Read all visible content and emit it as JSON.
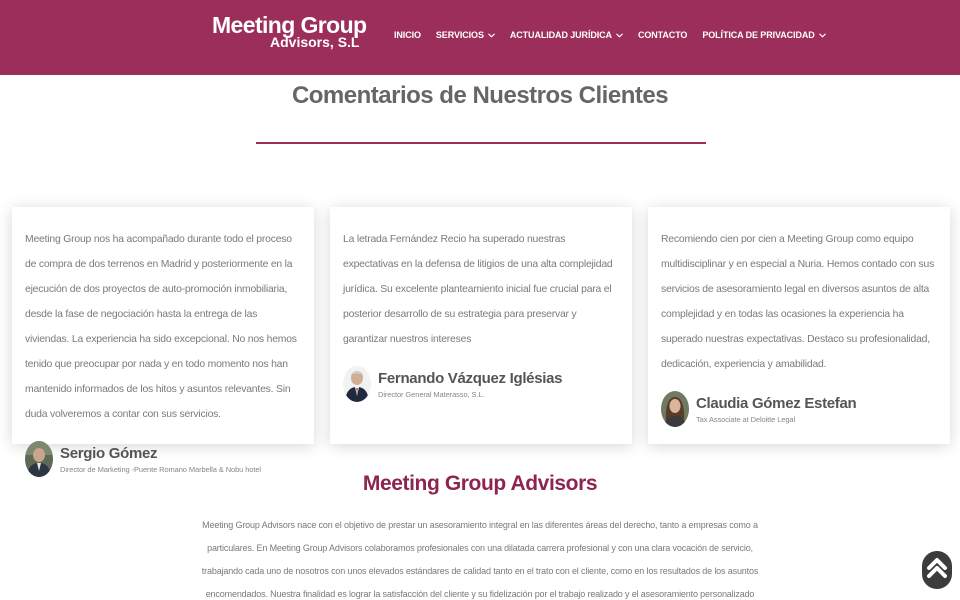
{
  "header": {
    "logo_line1": "Meeting Group",
    "logo_line2": "Advisors, S.L",
    "nav": [
      {
        "label": "INICIO",
        "dropdown": false
      },
      {
        "label": "SERVICIOS",
        "dropdown": true
      },
      {
        "label": "ACTUALIDAD JURÍDICA",
        "dropdown": true
      },
      {
        "label": "CONTACTO",
        "dropdown": false
      },
      {
        "label": "POLÍTICA DE PRIVACIDAD",
        "dropdown": true
      }
    ]
  },
  "testimonials": {
    "title": "Comentarios de Nuestros Clientes",
    "items": [
      {
        "text": "Meeting Group nos ha acompañado durante todo el proceso de compra de dos terrenos en Madrid y posteriormente en la ejecución de dos proyectos de auto-promoción inmobiliaria, desde la fase de negociación hasta la entrega de las viviendas. La experiencia ha sido excepcional. No nos hemos tenido que preocupar por nada y en todo momento nos han mantenido informados de los hitos y asuntos relevantes. Sin duda volveremos a contar con sus servicios.",
        "name": "Sergio Gómez",
        "role": "Director de Marketing -Puente Romano Marbella & Nobu hotel"
      },
      {
        "text": "La letrada Fernández Recio ha superado nuestras expectativas en la defensa de litigios de una alta complejidad jurídica. Su excelente planteamiento inicial fue crucial para el posterior desarrollo de su estrategia para preservar y garantizar nuestros intereses",
        "name": "Fernando Vázquez Iglésias",
        "role": "Director General Materasso, S.L."
      },
      {
        "text": "Recomiendo cien por cien a Meeting Group como equipo multidisciplinar y en especial a Nuria. Hemos contado con sus servicios de asesoramiento legal en diversos asuntos de alta complejidad y en todas las ocasiones la experiencia ha superado nuestras expectativas. Destaco su profesionalidad, dedicación, experiencia y amabilidad.",
        "name": "Claudia Gómez Estefan",
        "role": "Tax Associate at Deloitte Legal"
      }
    ]
  },
  "about": {
    "title": "Meeting Group Advisors",
    "text": "Meeting Group Advisors nace con el objetivo de prestar un asesoramiento integral en las diferentes áreas del derecho, tanto a empresas como a particulares. En Meeting Group Advisors colaboramos profesionales con una dilatada carrera profesional y con una clara vocación de servicio, trabajando cada uno de nosotros con unos elevados estándares de calidad tanto en el trato con el cliente, como en los resultados de los asuntos encomendados. Nuestra finalidad es lograr la satisfacción del cliente y su fidelización por el trabajo realizado y el asesoramiento personalizado recibido."
  },
  "colors": {
    "brand": "#9b2e5a",
    "accent_title": "#8e2450"
  },
  "icons": {
    "nav_dropdown": "chevron-down-icon",
    "scroll_top": "double-chevron-up-icon"
  }
}
